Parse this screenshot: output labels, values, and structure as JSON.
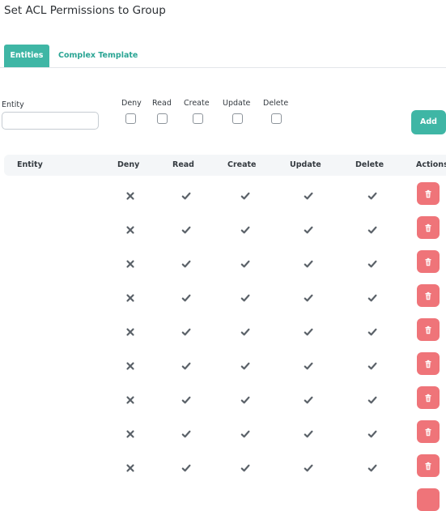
{
  "title": "Set ACL Permissions to Group",
  "tabs": [
    {
      "label": "Entities",
      "active": true
    },
    {
      "label": "Complex Template",
      "active": false
    }
  ],
  "form": {
    "entity_label": "Entity",
    "entity_value": "",
    "checkboxes": [
      "Deny",
      "Read",
      "Create",
      "Update",
      "Delete"
    ],
    "add_label": "Add"
  },
  "table": {
    "headers": [
      "Entity",
      "Deny",
      "Read",
      "Create",
      "Update",
      "Delete",
      "Actions"
    ],
    "rows": [
      {
        "entity": "",
        "deny": "x",
        "read": "check",
        "create": "check",
        "update": "check",
        "delete": "check"
      },
      {
        "entity": "",
        "deny": "x",
        "read": "check",
        "create": "check",
        "update": "check",
        "delete": "check"
      },
      {
        "entity": "",
        "deny": "x",
        "read": "check",
        "create": "check",
        "update": "check",
        "delete": "check"
      },
      {
        "entity": "",
        "deny": "x",
        "read": "check",
        "create": "check",
        "update": "check",
        "delete": "check"
      },
      {
        "entity": "",
        "deny": "x",
        "read": "check",
        "create": "check",
        "update": "check",
        "delete": "check"
      },
      {
        "entity": "",
        "deny": "x",
        "read": "check",
        "create": "check",
        "update": "check",
        "delete": "check"
      },
      {
        "entity": "",
        "deny": "x",
        "read": "check",
        "create": "check",
        "update": "check",
        "delete": "check"
      },
      {
        "entity": "",
        "deny": "x",
        "read": "check",
        "create": "check",
        "update": "check",
        "delete": "check"
      },
      {
        "entity": "",
        "deny": "x",
        "read": "check",
        "create": "check",
        "update": "check",
        "delete": "check"
      }
    ]
  },
  "colors": {
    "accent": "#3fb6a5",
    "danger": "#ef7479",
    "icon": "#5a6168"
  },
  "icons": {
    "deny": "x-icon",
    "allow": "check-icon",
    "delete_action": "trash-icon"
  }
}
